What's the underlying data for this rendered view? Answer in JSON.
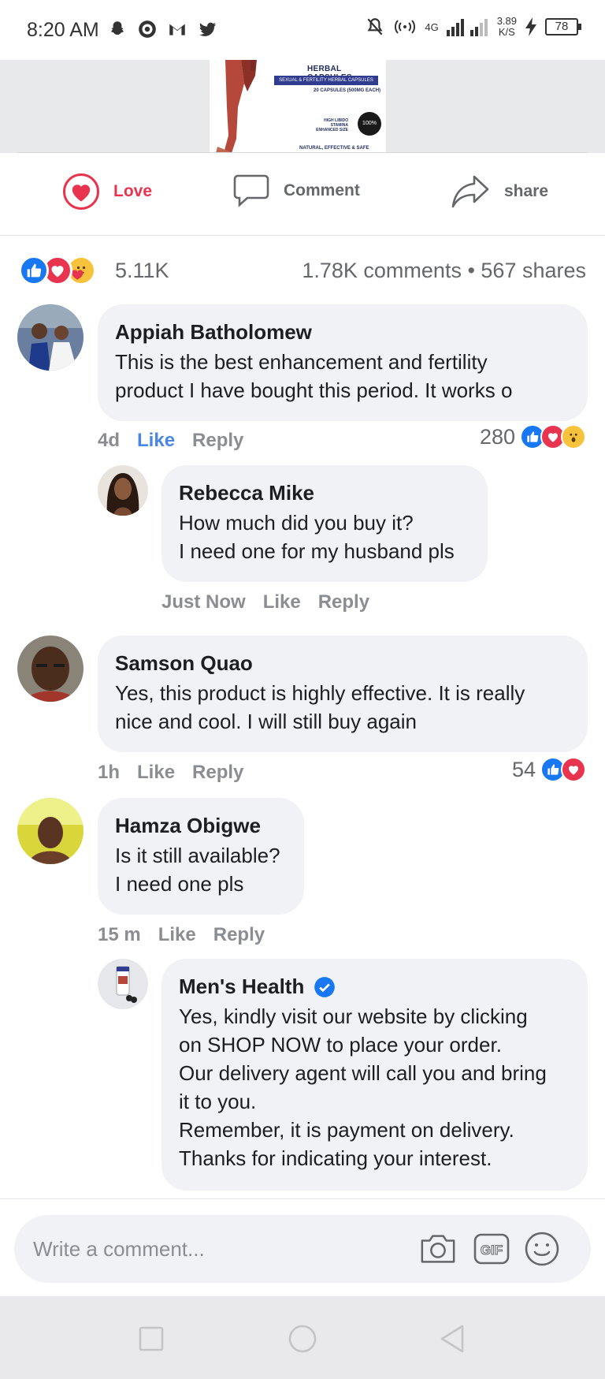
{
  "status_bar": {
    "time": "8:20 AM",
    "network": "4G",
    "speed_value": "3.89",
    "speed_unit": "K/S",
    "battery": "78",
    "left_icons": [
      "snapchat-icon",
      "app-icon",
      "gmail-icon",
      "twitter-icon"
    ],
    "right_icons": [
      "mute-icon",
      "hotspot-icon",
      "signal-icon",
      "charging-icon"
    ]
  },
  "ad": {
    "title": "HERBAL CAPSULES",
    "strip": "SEXUAL & FERTILITY HERBAL CAPSULES",
    "sub": "20 CAPSULES (500MG EACH)",
    "features": "HIGH LIBIDO STAMINA ENHANCED SIZE",
    "seal": "100%",
    "footer": "NATURAL, EFFECTIVE & SAFE"
  },
  "actions": {
    "love": "Love",
    "comment": "Comment",
    "share": "share"
  },
  "summary": {
    "reaction_count": "5.11K",
    "comments_shares": "1.78K comments • 567 shares",
    "reactions": [
      "like",
      "love",
      "care"
    ]
  },
  "comments": [
    {
      "name": "Appiah Batholomew",
      "text_lines": [
        "This is the best enhancement and fertility",
        "product I have bought this period. It works o"
      ],
      "time": "4d",
      "like": "Like",
      "reply": "Reply",
      "reaction_count": "280",
      "reactions": [
        "like",
        "love",
        "wow"
      ]
    },
    {
      "name": "Rebecca Mike",
      "text_lines": [
        "How much did you buy it?",
        "I need one for my husband pls"
      ],
      "time": "Just Now",
      "like": "Like",
      "reply": "Reply"
    },
    {
      "name": "Samson Quao",
      "text_lines": [
        "Yes, this product is highly effective. It is really",
        "nice and cool. I will still buy again"
      ],
      "time": "1h",
      "like": "Like",
      "reply": "Reply",
      "reaction_count": "54",
      "reactions": [
        "like",
        "love"
      ]
    },
    {
      "name": "Hamza Obigwe",
      "text_lines": [
        "Is it still available?",
        "I need one pls"
      ],
      "time": "15 m",
      "like": "Like",
      "reply": "Reply"
    },
    {
      "name": "Men's Health",
      "verified": true,
      "text_lines": [
        "Yes, kindly visit our website by clicking",
        "on SHOP NOW to place your order.",
        "Our delivery agent will call you and bring",
        "it to you.",
        "Remember, it is payment on delivery.",
        "Thanks for indicating your interest."
      ]
    }
  ],
  "composer": {
    "placeholder": "Write a comment...",
    "gif_label": "GIF"
  },
  "colors": {
    "love": "#e8344e",
    "like_blue": "#1877f2",
    "bubble": "#f0f2f5",
    "muted": "#65676b"
  }
}
